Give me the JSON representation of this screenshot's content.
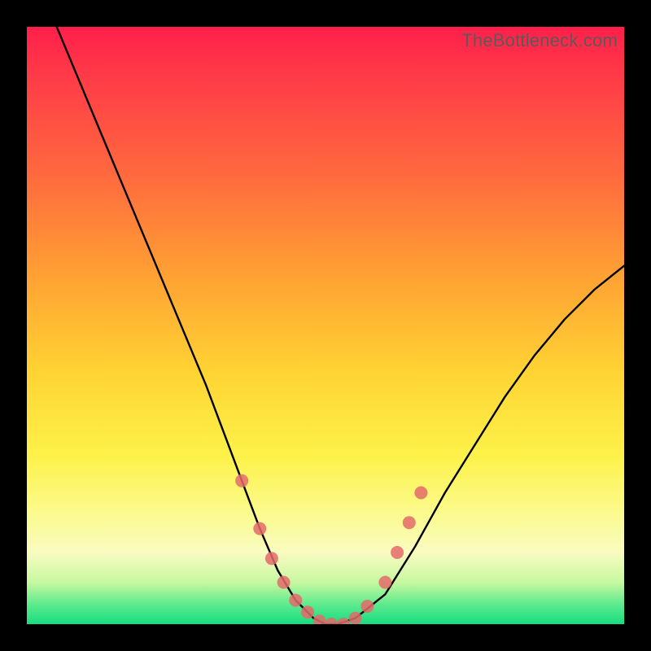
{
  "watermark": "TheBottleneck.com",
  "chart_data": {
    "type": "line",
    "title": "",
    "xlabel": "",
    "ylabel": "",
    "xlim": [
      0,
      100
    ],
    "ylim": [
      0,
      100
    ],
    "series": [
      {
        "name": "bottleneck-curve",
        "x": [
          5,
          10,
          15,
          20,
          25,
          30,
          33,
          36,
          39,
          42,
          45,
          48,
          50,
          52,
          55,
          60,
          65,
          70,
          75,
          80,
          85,
          90,
          95,
          100
        ],
        "y": [
          100,
          88,
          76,
          64,
          52,
          40,
          32,
          24,
          16,
          9,
          4,
          1,
          0,
          0,
          1,
          5,
          13,
          22,
          30,
          38,
          45,
          51,
          56,
          60
        ]
      }
    ],
    "markers": {
      "name": "highlight-dots",
      "color": "#e46a6a",
      "points": [
        {
          "x": 36,
          "y": 24
        },
        {
          "x": 39,
          "y": 16
        },
        {
          "x": 41,
          "y": 11
        },
        {
          "x": 43,
          "y": 7
        },
        {
          "x": 45,
          "y": 4
        },
        {
          "x": 47,
          "y": 2
        },
        {
          "x": 49,
          "y": 0.5
        },
        {
          "x": 51,
          "y": 0
        },
        {
          "x": 53,
          "y": 0
        },
        {
          "x": 55,
          "y": 1
        },
        {
          "x": 57,
          "y": 3
        },
        {
          "x": 60,
          "y": 7
        },
        {
          "x": 62,
          "y": 12
        },
        {
          "x": 64,
          "y": 17
        },
        {
          "x": 66,
          "y": 22
        }
      ]
    }
  }
}
